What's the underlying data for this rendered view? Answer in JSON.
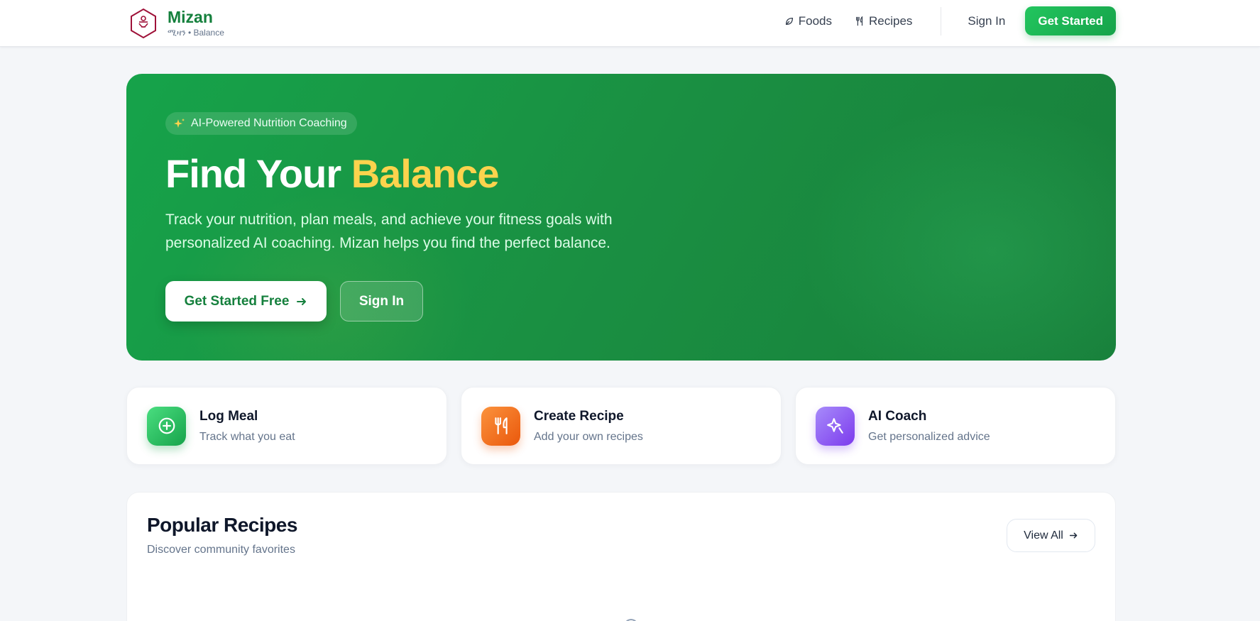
{
  "header": {
    "brand_name": "Mizan",
    "brand_subtitle": "ሚዛን • Balance",
    "nav": [
      {
        "label": "Foods",
        "icon": "leaf-icon"
      },
      {
        "label": "Recipes",
        "icon": "utensils-icon"
      }
    ],
    "sign_in_label": "Sign In",
    "get_started_label": "Get Started"
  },
  "hero": {
    "badge": "AI-Powered Nutrition Coaching",
    "title_main": "Find Your ",
    "title_accent": "Balance",
    "description": "Track your nutrition, plan meals, and achieve your fitness goals with personalized AI coaching. Mizan helps you find the perfect balance.",
    "cta_primary": "Get Started Free",
    "cta_secondary": "Sign In"
  },
  "actions": [
    {
      "title": "Log Meal",
      "subtitle": "Track what you eat",
      "icon": "plus-circle-icon",
      "color": "#22c55e"
    },
    {
      "title": "Create Recipe",
      "subtitle": "Add your own recipes",
      "icon": "utensils-icon",
      "color": "#f97316"
    },
    {
      "title": "AI Coach",
      "subtitle": "Get personalized advice",
      "icon": "sparkle-icon",
      "color": "#8b5cf6"
    }
  ],
  "recipes": {
    "title": "Popular Recipes",
    "subtitle": "Discover community favorites",
    "view_all_label": "View All"
  },
  "colors": {
    "brand_green": "#16a34a",
    "accent_yellow": "#fcd34d",
    "background": "#f4f6f9"
  }
}
